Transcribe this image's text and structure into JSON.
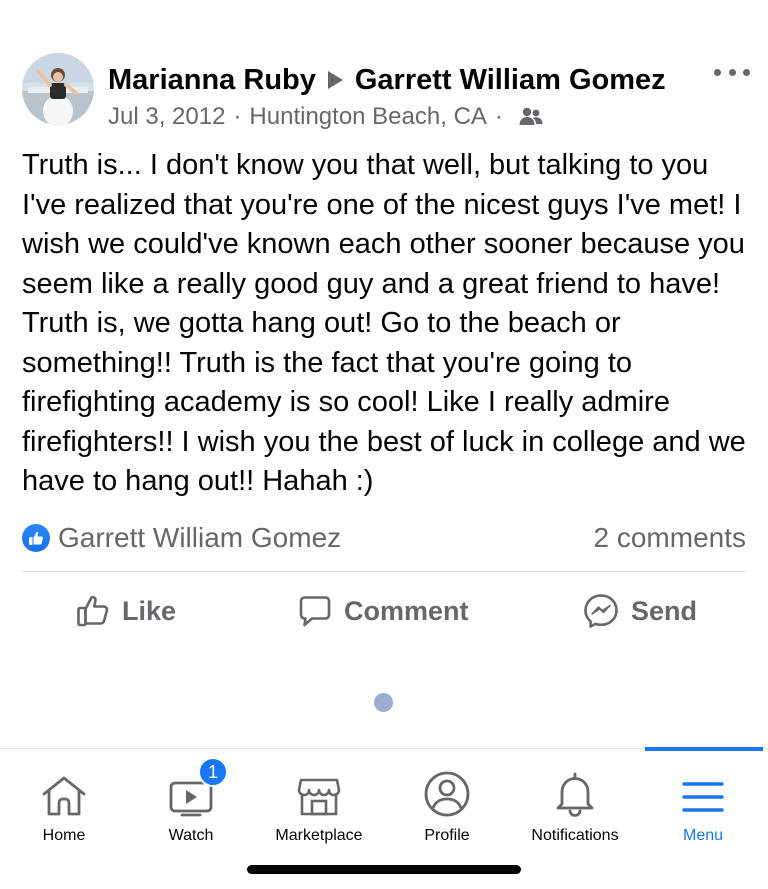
{
  "post": {
    "author": "Marianna Ruby",
    "target": "Garrett William Gomez",
    "date": "Jul 3, 2012",
    "separator": "·",
    "location": "Huntington Beach, CA",
    "audience_icon": "friends-icon",
    "more_icon": "more-horizontal-icon",
    "text": "Truth is... I don't know you that well, but talking to you I've realized that you're one of the nicest guys I've met! I wish we could've known each other sooner because you seem like a really good guy and a great friend to have! Truth is, we gotta hang out! Go to the beach or something!! Truth is the fact that you're going to firefighting academy is so cool! Like I really admire firefighters!! I wish you the best of luck in college and we have to hang out!! Hahah :)",
    "reactions": {
      "icon": "like-reaction-icon",
      "names": "Garrett William Gomez",
      "comments": "2 comments"
    },
    "actions": [
      {
        "label": "Like",
        "icon": "thumbs-up-icon"
      },
      {
        "label": "Comment",
        "icon": "comment-bubble-icon"
      },
      {
        "label": "Send",
        "icon": "messenger-icon"
      }
    ]
  },
  "tabbar": {
    "items": [
      {
        "label": "Home",
        "icon": "home-icon"
      },
      {
        "label": "Watch",
        "icon": "video-icon",
        "badge": "1"
      },
      {
        "label": "Marketplace",
        "icon": "shop-icon"
      },
      {
        "label": "Profile",
        "icon": "profile-icon"
      },
      {
        "label": "Notifications",
        "icon": "bell-icon"
      },
      {
        "label": "Menu",
        "icon": "hamburger-icon",
        "active": true
      }
    ]
  },
  "colors": {
    "accent": "#1877f2",
    "secondary_text": "#65676b",
    "primary_text": "#050505",
    "divider": "#dadde1"
  }
}
